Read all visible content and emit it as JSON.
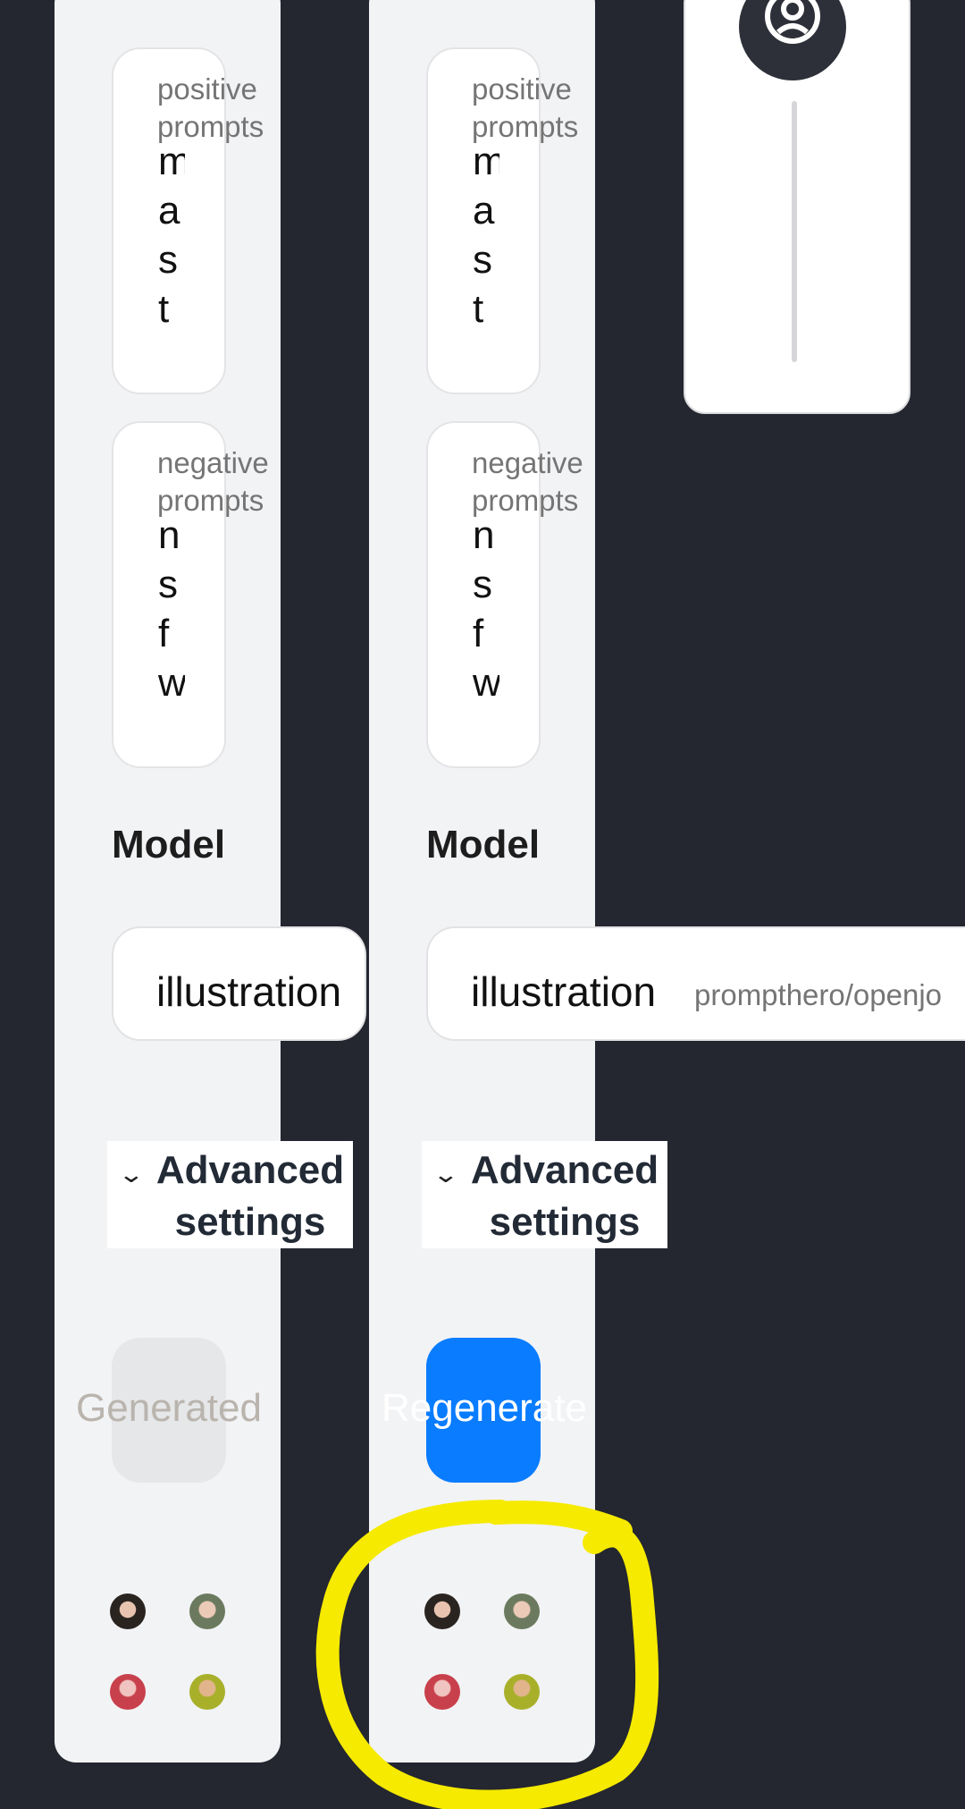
{
  "panels": [
    {
      "positive_label": "positive\nprompts",
      "positive_text": "mast",
      "negative_label": "negative\nprompts",
      "negative_text": "nsfw",
      "model_title": "Model",
      "model_value": "illustration",
      "advanced_label": "Advanced settings",
      "button_label": "Generated",
      "button_state": "disabled"
    },
    {
      "positive_label": "positive\nprompts",
      "positive_text": "mast",
      "negative_label": "negative\nprompts",
      "negative_text": "nsfw",
      "model_title": "Model",
      "model_value": "illustration",
      "model_path": "prompthero/openjo",
      "advanced_label": "Advanced settings",
      "button_label": "Regenerate",
      "button_state": "active"
    }
  ],
  "colors": {
    "background": "#242630",
    "accent": "#0a7cff",
    "highlight": "#f5ea00",
    "disabled_button": "#e6e7e9",
    "disabled_text": "#b9b4ad"
  },
  "icons": {
    "avatar": "user-circle-icon",
    "expand": "chevron-down-icon"
  }
}
